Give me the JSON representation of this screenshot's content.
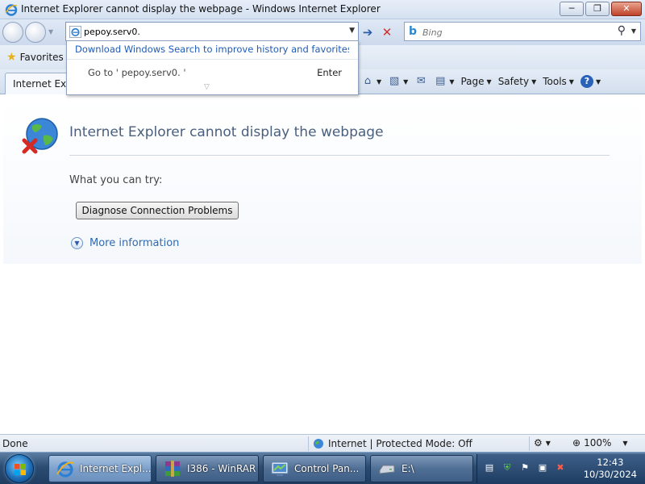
{
  "window": {
    "title": "Internet Explorer cannot display the webpage - Windows Internet Explorer",
    "minimize": "─",
    "maximize": "❐",
    "close": "✕"
  },
  "address_bar": {
    "value": "pepoy.serv0.",
    "go_icon": "➔",
    "stop_icon": "✕"
  },
  "search": {
    "placeholder": "Bing",
    "provider_icon": "b"
  },
  "autocomplete": {
    "link": "Download Windows Search to improve history and favorites r...",
    "goto": "Go to ' pepoy.serv0. '",
    "enter": "Enter"
  },
  "favorites": {
    "label": "Favorites"
  },
  "tab": {
    "label": "Internet Explorer cannot display the webpage"
  },
  "commands": {
    "page": "Page",
    "safety": "Safety",
    "tools": "Tools",
    "help": "?"
  },
  "content": {
    "error_title": "Internet Explorer cannot display the webpage",
    "try_label": "What you can try:",
    "diagnose_button": "Diagnose Connection Problems",
    "more_info": "More information"
  },
  "status": {
    "text": "Done",
    "zone": "Internet | Protected Mode: Off",
    "zoom": "100%"
  },
  "taskbar": {
    "items": [
      {
        "label": "Internet Expl..."
      },
      {
        "label": "I386 - WinRAR"
      },
      {
        "label": "Control Pan..."
      },
      {
        "label": "E:\\"
      }
    ],
    "time": "12:43",
    "date": "10/30/2024"
  }
}
